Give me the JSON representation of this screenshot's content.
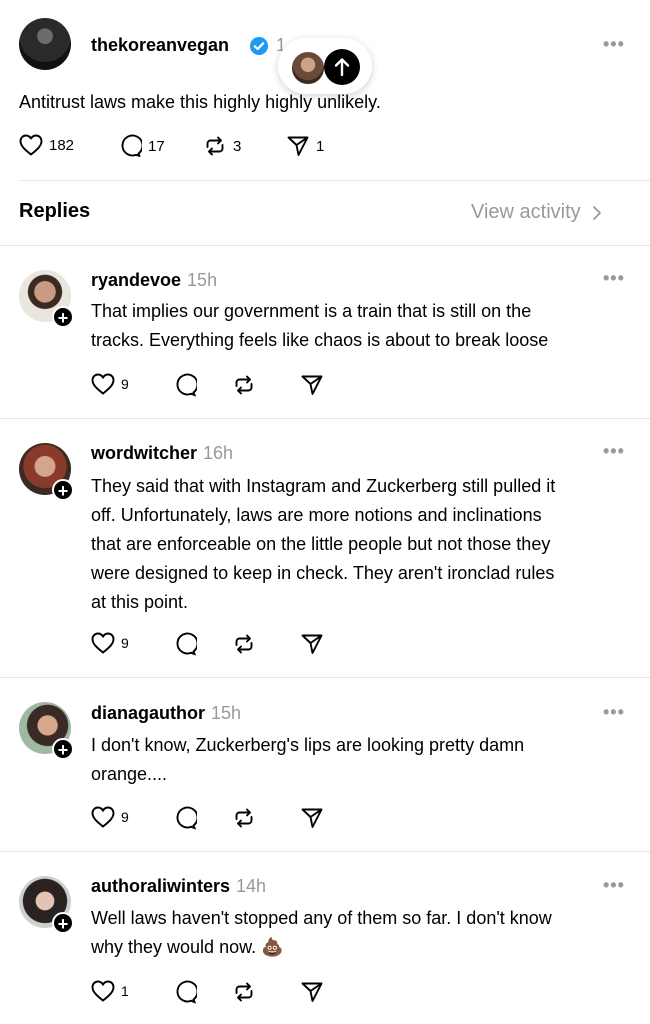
{
  "op": {
    "username": "thekoreanvegan",
    "time_partial": "1",
    "text": "Antitrust laws make this highly highly unlikely.",
    "likes": "182",
    "replies": "17",
    "reposts": "3",
    "shares": "1"
  },
  "replies_header": {
    "title": "Replies",
    "view_activity": "View activity"
  },
  "colors": {
    "verified": "#1d9bf0",
    "muted": "#999999",
    "divider": "#e6e6e6"
  },
  "replies": [
    {
      "username": "ryandevoe",
      "time": "15h",
      "lines": [
        "That implies our government is a train that is still on the",
        "tracks. Everything feels like chaos is about to break loose"
      ],
      "likes": "9"
    },
    {
      "username": "wordwitcher",
      "time": "16h",
      "lines": [
        "They said that with Instagram and Zuckerberg still pulled it",
        "off. Unfortunately, laws are more notions and inclinations",
        "that are enforceable on the little people but not those they",
        "were designed to keep in check. They aren't ironclad rules",
        "at this point."
      ],
      "likes": "9"
    },
    {
      "username": "dianagauthor",
      "time": "15h",
      "lines": [
        "I don't know, Zuckerberg's lips are looking pretty damn",
        "orange...."
      ],
      "likes": "9"
    },
    {
      "username": "authoraliwinters",
      "time": "14h",
      "lines": [
        "Well laws haven't stopped any of them so far. I don't know",
        "why they would now. 💩"
      ],
      "likes": "1"
    }
  ]
}
